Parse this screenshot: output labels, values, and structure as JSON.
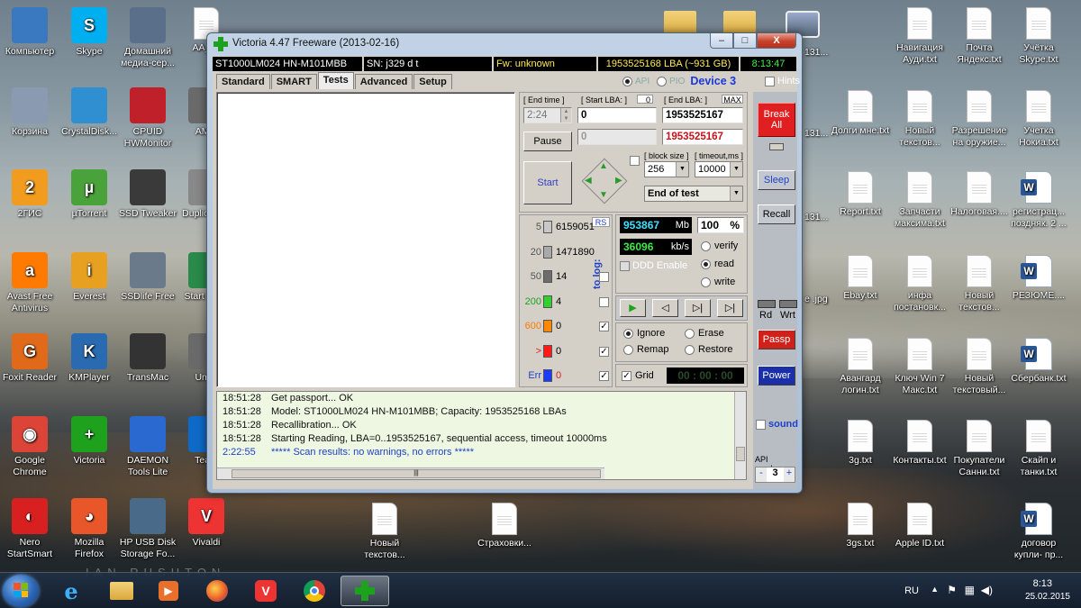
{
  "desktop": {
    "icons_left": [
      {
        "label": "Компьютер",
        "icon": "computer-icon"
      },
      {
        "label": "Skype",
        "icon": "skype-icon"
      },
      {
        "label": "Домашний медиа-сер...",
        "icon": "media-server-icon"
      },
      {
        "label": "AA_v3",
        "icon": "document-icon"
      },
      {
        "label": "Корзина",
        "icon": "recycle-bin-icon"
      },
      {
        "label": "CrystalDisk...",
        "icon": "crystaldisk-icon"
      },
      {
        "label": "CPUID HWMonitor",
        "icon": "hwmonitor-icon"
      },
      {
        "label": "AMM",
        "icon": "app-icon"
      },
      {
        "label": "2ГИС",
        "icon": "2gis-icon"
      },
      {
        "label": "µTorrent",
        "icon": "utorrent-icon"
      },
      {
        "label": "SSD Tweaker",
        "icon": "ssd-tweaker-icon"
      },
      {
        "label": "Duplic Clea",
        "icon": "duplicate-cleaner-icon"
      },
      {
        "label": "Avast Free Antivirus",
        "icon": "avast-icon"
      },
      {
        "label": "Everest",
        "icon": "everest-icon"
      },
      {
        "label": "SSDlife Free",
        "icon": "ssdlife-icon"
      },
      {
        "label": "Start Brow",
        "icon": "browser-icon"
      },
      {
        "label": "Foxit Reader",
        "icon": "foxit-icon"
      },
      {
        "label": "KMPlayer",
        "icon": "kmplayer-icon"
      },
      {
        "label": "TransMac",
        "icon": "transmac-icon"
      },
      {
        "label": "Umm",
        "icon": "app-icon"
      },
      {
        "label": "Google Chrome",
        "icon": "chrome-icon"
      },
      {
        "label": "Victoria",
        "icon": "victoria-icon"
      },
      {
        "label": "DAEMON Tools Lite",
        "icon": "daemon-tools-icon"
      },
      {
        "label": "Team",
        "icon": "teamviewer-icon"
      },
      {
        "label": "Nero StartSmart",
        "icon": "nero-icon"
      },
      {
        "label": "Mozilla Firefox",
        "icon": "firefox-icon"
      },
      {
        "label": "HP USB Disk Storage Fo...",
        "icon": "hp-usb-icon"
      },
      {
        "label": "Vivaldi",
        "icon": "vivaldi-icon"
      }
    ],
    "icons_bottom_mid": [
      {
        "label": "Новый текстов...",
        "icon": "document-icon"
      },
      {
        "label": "Страховки...",
        "icon": "document-icon"
      }
    ],
    "icons_top_mid": [
      {
        "label": "",
        "icon": "folder-icon"
      },
      {
        "label": "131...",
        "icon": "document-icon"
      }
    ],
    "icons_right": [
      {
        "label": "Навигация Ауди.txt"
      },
      {
        "label": "Почта Яндекс.txt"
      },
      {
        "label": "Учётка Skype.txt"
      },
      {
        "label": "Долги мне.txt"
      },
      {
        "label": "Новый текстов..."
      },
      {
        "label": "Разрешение на оружие..."
      },
      {
        "label": "Учетка Нокиа.txt"
      },
      {
        "label": "Report.txt"
      },
      {
        "label": "Запчасти максима.txt"
      },
      {
        "label": "Налоговая...."
      },
      {
        "label": "регистрац... поздняк. 2 ..."
      },
      {
        "label": "Ebay.txt"
      },
      {
        "label": "инфа постановк..."
      },
      {
        "label": "Новый текстов..."
      },
      {
        "label": "РЕЗЮМЕ...."
      },
      {
        "label": "Авангард логин.txt"
      },
      {
        "label": "Ключ Win 7 Макс.txt"
      },
      {
        "label": "Новый текстовый..."
      },
      {
        "label": "Сбербанк.txt"
      },
      {
        "label": "3g.txt"
      },
      {
        "label": "Контакты.txt"
      },
      {
        "label": "Покупатели Санни.txt"
      },
      {
        "label": "Скайп и танки.txt"
      },
      {
        "label": "3gs.txt"
      },
      {
        "label": "Apple ID.txt"
      },
      {
        "label": "договор купли- пр..."
      }
    ],
    "partial_labels": [
      "131...",
      "131...",
      "131...",
      "e .jpg"
    ],
    "watermark": "IAN RUSHTON"
  },
  "window": {
    "title": "Victoria 4.47  Freeware (2013-02-16)",
    "controls": {
      "min": "–",
      "max": "□",
      "close": "X"
    }
  },
  "statusbar": {
    "model": "ST1000LM024 HN-M101MBB",
    "serial": "SN:  j329        d t",
    "firmware": "Fw: unknown",
    "capacity": "1953525168 LBA (~931 GB)",
    "time": "8:13:47"
  },
  "tabs": [
    "Standard",
    "SMART",
    "Tests",
    "Advanced",
    "Setup"
  ],
  "active_tab": "Tests",
  "api": {
    "api_label": "API",
    "pio_label": "PIO",
    "device": "Device 3",
    "hints": "Hints"
  },
  "test": {
    "end_time_label": "[ End time ]",
    "end_time": "2:24",
    "start_lba_label": "[ Start LBA: ]",
    "start_lba_small": "0",
    "start_lba": "0",
    "end_lba_label": "[ End LBA: ]",
    "end_lba_max": "MAX",
    "end_lba": "1953525167",
    "current_lba": "1953525167",
    "current_grey": "0",
    "pause": "Pause",
    "start": "Start",
    "block_size_label": "[ block size ]",
    "block_size": "256",
    "timeout_label": "[ timeout,ms ]",
    "timeout": "10000",
    "end_action": "End of test"
  },
  "blocks": {
    "rs": "RS",
    "to_log": "to log:",
    "rows": [
      {
        "label": "5",
        "count": "6159051",
        "color": "#c8c8c8"
      },
      {
        "label": "20",
        "count": "1471890",
        "color": "#a9a9a9"
      },
      {
        "label": "50",
        "count": "14",
        "color": "#6d6d6d"
      },
      {
        "label": "200",
        "count": "4",
        "color": "#2fd12f"
      },
      {
        "label": "600",
        "count": "0",
        "color": "#ff8800"
      },
      {
        "label": ">",
        "count": "0",
        "color": "#ff1a1a"
      },
      {
        "label": "Err",
        "count": "0",
        "color": "#1a3cff"
      }
    ],
    "checked": [
      false,
      false,
      false,
      false,
      true,
      true,
      true
    ]
  },
  "stats": {
    "mb": "953867",
    "mb_unit": "Mb",
    "percent": "100",
    "percent_unit": "%",
    "speed": "36096",
    "speed_unit": "kb/s",
    "ddd": "DDD Enable",
    "verify": "verify",
    "read": "read",
    "write": "write"
  },
  "actions": {
    "ignore": "Ignore",
    "erase": "Erase",
    "remap": "Remap",
    "restore": "Restore"
  },
  "grid": {
    "label": "Grid",
    "timer": "00 : 00 : 00"
  },
  "log": [
    {
      "time": "18:51:28",
      "msg": "Get passport... OK"
    },
    {
      "time": "18:51:28",
      "msg": "Model: ST1000LM024 HN-M101MBB; Capacity: 1953525168 LBAs"
    },
    {
      "time": "18:51:28",
      "msg": "Recallibration... OK"
    },
    {
      "time": "18:51:28",
      "msg": "Starting Reading, LBA=0..1953525167, sequential access, timeout 10000ms"
    },
    {
      "time": "2:22:55",
      "msg": "***** Scan results: no warnings, no errors *****"
    }
  ],
  "right": {
    "break": "Break All",
    "sleep": "Sleep",
    "recall": "Recall",
    "rd": "Rd",
    "wrt": "Wrt",
    "passp": "Passp",
    "power": "Power",
    "sound": "sound",
    "api_number_label": "API number",
    "api_number": "3",
    "minus": "-",
    "plus": "+"
  },
  "taskbar": {
    "lang": "RU",
    "time": "8:13",
    "date": "25.02.2015"
  }
}
